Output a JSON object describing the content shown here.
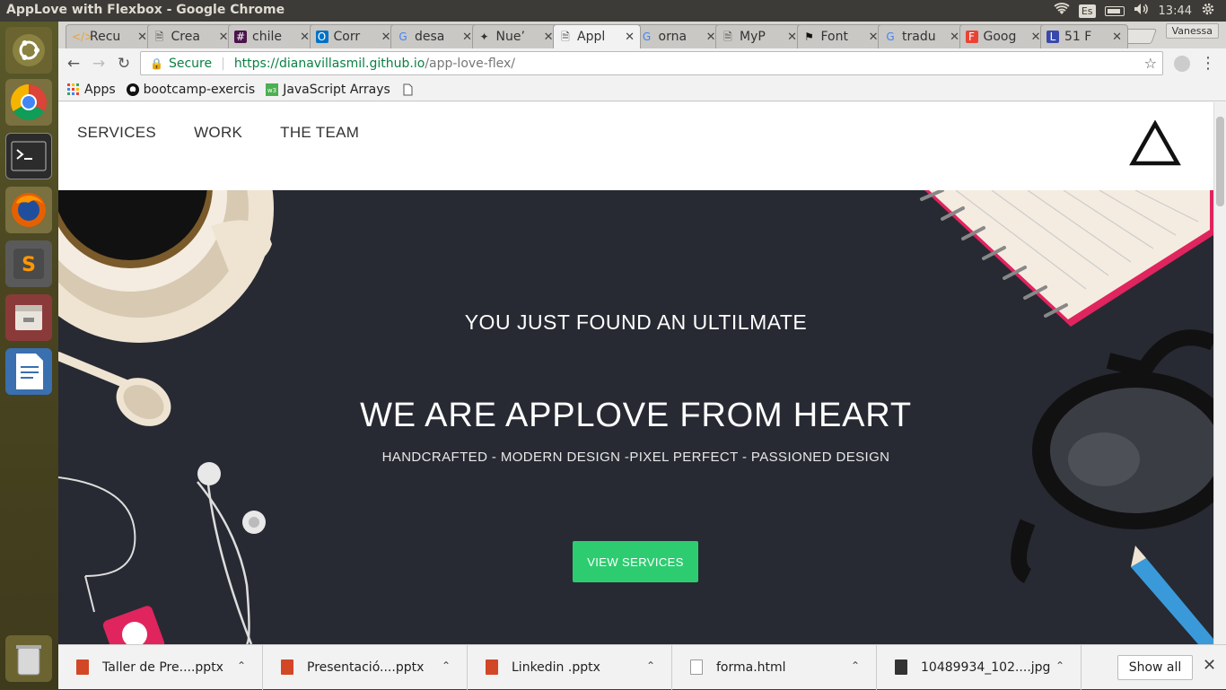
{
  "window": {
    "title": "AppLove with Flexbox - Google Chrome"
  },
  "tray": {
    "keyboard_lang": "Es",
    "clock": "13:44"
  },
  "tabs": [
    {
      "label": "Recu",
      "icon": "code-icon"
    },
    {
      "label": "Crea",
      "icon": "page-icon"
    },
    {
      "label": "chile",
      "icon": "slack-icon"
    },
    {
      "label": "Corr",
      "icon": "outlook-icon"
    },
    {
      "label": "desa",
      "icon": "google-icon"
    },
    {
      "label": "Nue’",
      "icon": "script-icon"
    },
    {
      "label": "Appl",
      "icon": "page-icon",
      "active": true
    },
    {
      "label": "orna",
      "icon": "google-icon"
    },
    {
      "label": "MyP",
      "icon": "page-icon"
    },
    {
      "label": "Font",
      "icon": "flag-icon"
    },
    {
      "label": "tradu",
      "icon": "google-icon"
    },
    {
      "label": "Goog",
      "icon": "fonts-icon"
    },
    {
      "label": "51 F",
      "icon": "l-icon"
    }
  ],
  "profile": "Vanessa",
  "address": {
    "secure_label": "Secure",
    "host": "https://dianavillasmil.github.io",
    "path": "/app-love-flex/"
  },
  "bookmarks": [
    {
      "label": "Apps",
      "icon": "apps-grid-icon"
    },
    {
      "label": "bootcamp-exercis",
      "icon": "github-icon"
    },
    {
      "label": "JavaScript Arrays",
      "icon": "w3-icon"
    },
    {
      "label": "",
      "icon": "page-icon"
    }
  ],
  "site": {
    "nav": [
      "SERVICES",
      "WORK",
      "THE TEAM"
    ],
    "hero_sub": "YOU JUST FOUND AN ULTILMATE",
    "hero_title": "WE ARE APPLOVE FROM HEART",
    "hero_tag": "HANDCRAFTED - MODERN DESIGN -PIXEL PERFECT - PASSIONED DESIGN",
    "cta": "VIEW SERVICES"
  },
  "downloads": [
    {
      "name": "Taller de Pre....pptx",
      "type": "pptx"
    },
    {
      "name": "Presentació....pptx",
      "type": "pptx"
    },
    {
      "name": "Linkedin .pptx",
      "type": "pptx"
    },
    {
      "name": "forma.html",
      "type": "html"
    },
    {
      "name": "10489934_102....jpg",
      "type": "jpg"
    }
  ],
  "show_all": "Show all",
  "colors": {
    "accent_green": "#2ecc71",
    "hero_bg": "#272a33",
    "secure_green": "#0b8043"
  }
}
